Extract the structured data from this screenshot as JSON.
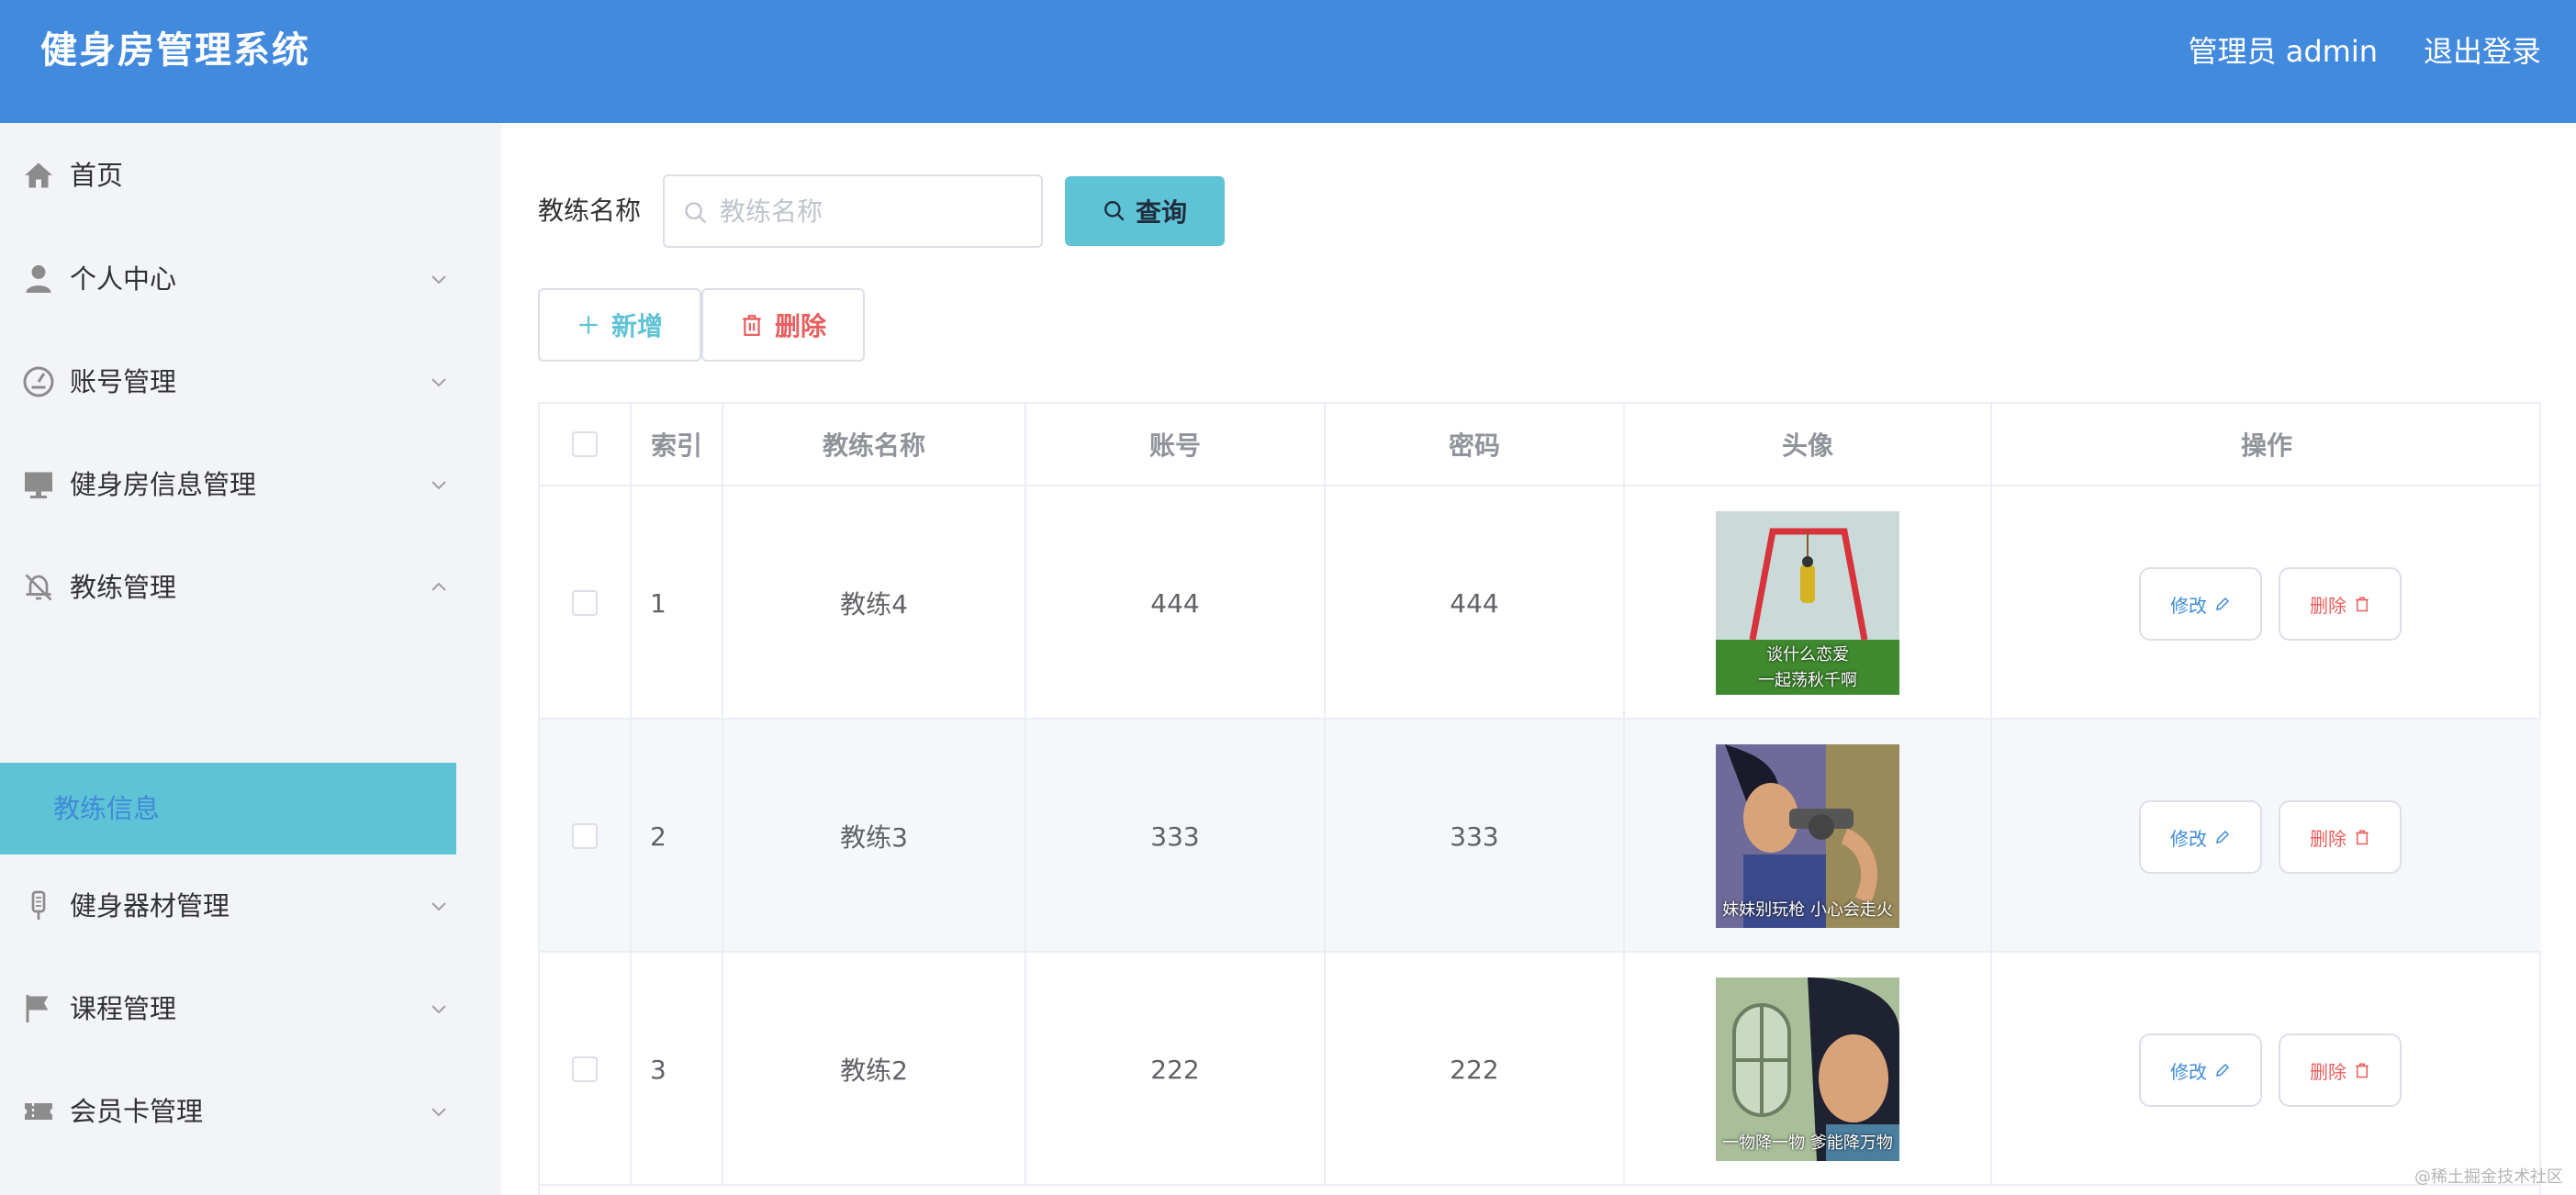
{
  "header": {
    "title": "健身房管理系统",
    "user": "管理员 admin",
    "logout": "退出登录"
  },
  "sidebar": {
    "items": [
      {
        "label": "首页",
        "icon": "home-icon"
      },
      {
        "label": "个人中心",
        "icon": "user-icon"
      },
      {
        "label": "账号管理",
        "icon": "dashboard-icon"
      },
      {
        "label": "健身房信息管理",
        "icon": "monitor-icon"
      },
      {
        "label": "教练管理",
        "icon": "bell-off-icon"
      },
      {
        "label": "健身器材管理",
        "icon": "microphone-icon"
      },
      {
        "label": "课程管理",
        "icon": "flag-icon"
      },
      {
        "label": "会员卡管理",
        "icon": "ticket-icon"
      }
    ],
    "active_sub": "教练信息"
  },
  "search": {
    "label": "教练名称",
    "placeholder": "教练名称",
    "button": "查询"
  },
  "actions": {
    "add": "新增",
    "delete": "删除"
  },
  "table": {
    "headers": [
      "索引",
      "教练名称",
      "账号",
      "密码",
      "头像",
      "操作"
    ],
    "rows": [
      {
        "index": "1",
        "name": "教练4",
        "account": "444",
        "password": "444",
        "avatar_caption_1": "谈什么恋爱",
        "avatar_caption_2": "一起荡秋千啊"
      },
      {
        "index": "2",
        "name": "教练3",
        "account": "333",
        "password": "333",
        "avatar_caption_1": "妹妹别玩枪 小心会走火"
      },
      {
        "index": "3",
        "name": "教练2",
        "account": "222",
        "password": "222",
        "avatar_caption_1": "一物降一物 爹能降万物"
      }
    ],
    "edit_label": "修改",
    "delete_label": "删除"
  },
  "watermark": "@稀土掘金技术社区",
  "colors": {
    "header": "#428add",
    "accent": "#5fc3d6",
    "danger": "#e85d5d",
    "link": "#3f8bd8"
  }
}
